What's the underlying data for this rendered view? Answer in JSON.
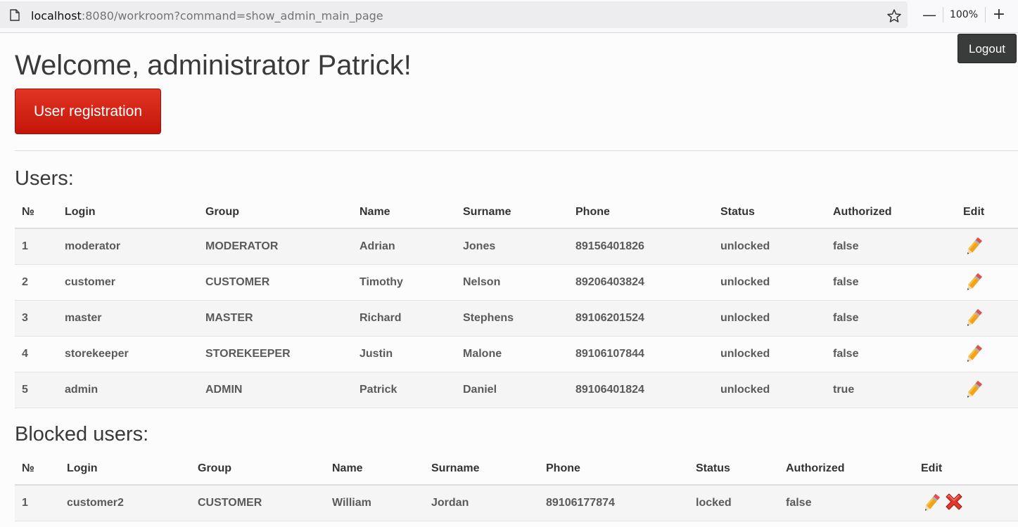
{
  "browser": {
    "url_host": "localhost",
    "url_rest": ":8080/workroom?command=show_admin_main_page",
    "zoom_minus": "—",
    "zoom_level": "100%",
    "zoom_plus": "+"
  },
  "header": {
    "logout_label": "Logout",
    "welcome": "Welcome, administrator Patrick!",
    "registration_label": "User registration"
  },
  "users": {
    "title": "Users:",
    "columns": [
      "№",
      "Login",
      "Group",
      "Name",
      "Surname",
      "Phone",
      "Status",
      "Authorized",
      "Edit"
    ],
    "rows": [
      {
        "num": "1",
        "login": "moderator",
        "group": "MODERATOR",
        "name": "Adrian",
        "surname": "Jones",
        "phone": "89156401826",
        "status": "unlocked",
        "authorized": "false"
      },
      {
        "num": "2",
        "login": "customer",
        "group": "CUSTOMER",
        "name": "Timothy",
        "surname": "Nelson",
        "phone": "89206403824",
        "status": "unlocked",
        "authorized": "false"
      },
      {
        "num": "3",
        "login": "master",
        "group": "MASTER",
        "name": "Richard",
        "surname": "Stephens",
        "phone": "89106201524",
        "status": "unlocked",
        "authorized": "false"
      },
      {
        "num": "4",
        "login": "storekeeper",
        "group": "STOREKEEPER",
        "name": "Justin",
        "surname": "Malone",
        "phone": "89106107844",
        "status": "unlocked",
        "authorized": "false"
      },
      {
        "num": "5",
        "login": "admin",
        "group": "ADMIN",
        "name": "Patrick",
        "surname": "Daniel",
        "phone": "89106401824",
        "status": "unlocked",
        "authorized": "true"
      }
    ]
  },
  "blocked_users": {
    "title": "Blocked users:",
    "columns": [
      "№",
      "Login",
      "Group",
      "Name",
      "Surname",
      "Phone",
      "Status",
      "Authorized",
      "Edit"
    ],
    "rows": [
      {
        "num": "1",
        "login": "customer2",
        "group": "CUSTOMER",
        "name": "William",
        "surname": "Jordan",
        "phone": "89106177874",
        "status": "locked",
        "authorized": "false"
      }
    ]
  },
  "icons": {
    "edit": "pencil-icon",
    "delete": "red-x-icon"
  },
  "colors": {
    "registration_button": "#d32414",
    "logout_button": "#3a3c3b"
  }
}
